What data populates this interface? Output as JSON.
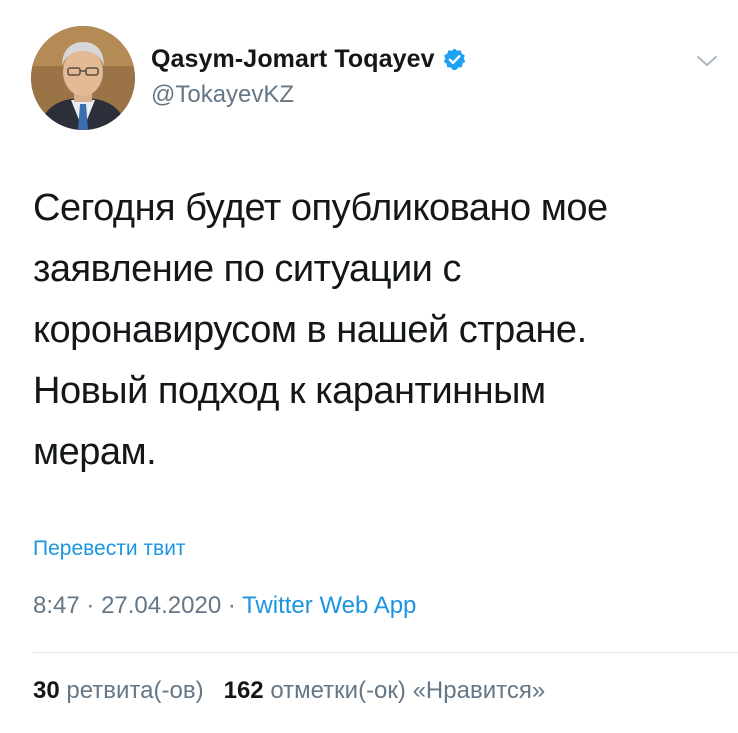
{
  "author": {
    "display_name": "Qasym-Jomart Toqayev",
    "handle": "@TokayevKZ",
    "verified": true,
    "verified_color": "#1da1f2"
  },
  "tweet": {
    "text": "Сегодня будет опубликовано мое\nзаявление по ситуации с\nкоронавирусом в нашей стране.\nНовый подход к карантинным\nмерам.",
    "translate_label": "Перевести твит",
    "time": "8:47",
    "date": "27.04.2020",
    "separator": "·",
    "source": "Twitter Web App"
  },
  "stats": {
    "retweets_count": "30",
    "retweets_label": "ретвита(-ов)",
    "likes_count": "162",
    "likes_label": "отметки(-ок) «Нравится»"
  },
  "icons": {
    "verified": "verified-badge-icon",
    "caret": "chevron-down-icon"
  },
  "colors": {
    "link": "#1b95e0",
    "secondary_text": "#657786",
    "primary_text": "#14171a"
  }
}
